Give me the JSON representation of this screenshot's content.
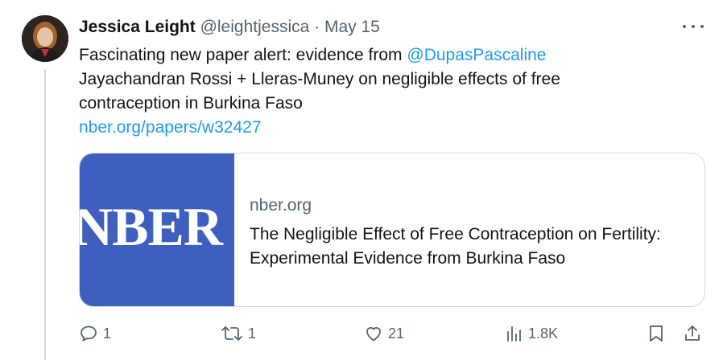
{
  "tweet": {
    "author_name": "Jessica Leight",
    "handle": "@leightjessica",
    "separator": "·",
    "date": "May 15",
    "text_line1": "Fascinating new paper alert: evidence from ",
    "mention": "@DupasPascaline",
    "text_line2": "Jayachandran Rossi + Lleras-Muney on negligible effects of free",
    "text_line3": "contraception in Burkina Faso",
    "link": "nber.org/papers/w32427"
  },
  "card": {
    "logo_text": "NBER",
    "domain": "nber.org",
    "title": "The Negligible Effect of Free Contraception on Fertility: Experimental Evidence from Burkina Faso",
    "image_color": "#3f5fbf"
  },
  "actions": {
    "replies": "1",
    "retweets": "1",
    "likes": "21",
    "views": "1.8K"
  },
  "colors": {
    "link": "#1d9bf0",
    "secondary": "#536471",
    "text": "#0f1419"
  }
}
